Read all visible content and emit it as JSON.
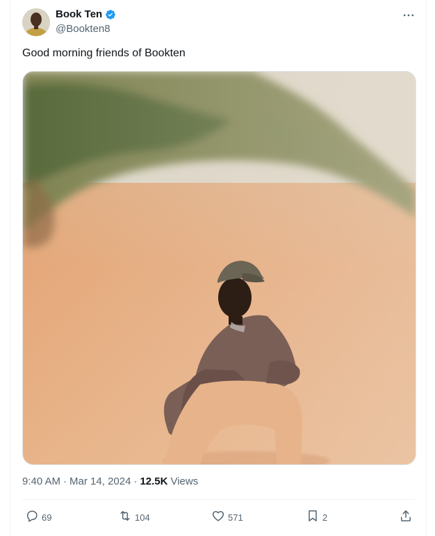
{
  "author": {
    "display_name": "Book Ten",
    "handle": "@Bookten8",
    "verified": true
  },
  "tweet": {
    "text": "Good morning friends of Bookten",
    "time": "9:40 AM",
    "date": "Mar 14, 2024",
    "views_count": "12.5K",
    "views_label": "Views",
    "separator": "·"
  },
  "actions": {
    "replies": "69",
    "retweets": "104",
    "likes": "571",
    "bookmarks": "2"
  },
  "colors": {
    "text_primary": "#0f1419",
    "text_secondary": "#536471",
    "verified_blue": "#1d9bf0",
    "border": "#eff3f4"
  },
  "icons": [
    "verified-badge-icon",
    "more-icon",
    "reply-icon",
    "retweet-icon",
    "like-icon",
    "bookmark-icon",
    "share-icon"
  ]
}
